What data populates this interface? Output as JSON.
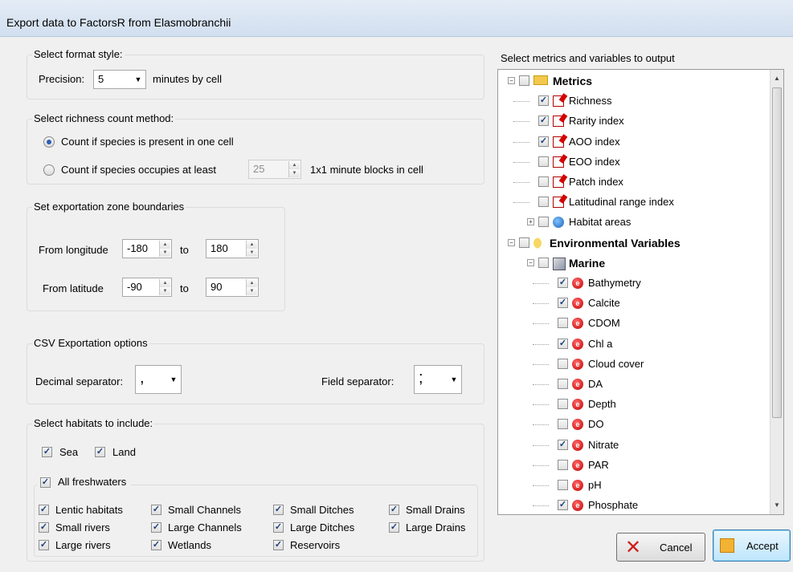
{
  "window": {
    "title": "Export data to FactorsR from Elasmobranchii"
  },
  "format": {
    "legend": "Select format style:",
    "precision_label": "Precision:",
    "precision_value": "5",
    "precision_suffix": "minutes by cell"
  },
  "richness": {
    "legend": "Select richness count method:",
    "option1": "Count if species is present in one cell",
    "option2_prefix": "Count if species occupies at least",
    "option2_value": "25",
    "option2_suffix": "1x1 minute blocks in cell",
    "selected": 1
  },
  "zone": {
    "legend": "Set exportation zone boundaries",
    "longitude_label": "From longitude",
    "longitude_from": "-180",
    "longitude_to": "180",
    "latitude_label": "From latitude",
    "latitude_from": "-90",
    "latitude_to": "90",
    "to_label": "to"
  },
  "csv": {
    "legend": "CSV Exportation options",
    "decimal_label": "Decimal separator:",
    "decimal_value": ",",
    "field_label": "Field separator:",
    "field_value": ";"
  },
  "habitats": {
    "legend": "Select habitats to include:",
    "sea": "Sea",
    "land": "Land",
    "all_freshwaters": "All freshwaters",
    "items": [
      {
        "label": "Lentic habitats",
        "checked": true
      },
      {
        "label": "Small Channels",
        "checked": true
      },
      {
        "label": "Small Ditches",
        "checked": true
      },
      {
        "label": "Small Drains",
        "checked": true
      },
      {
        "label": "Small rivers",
        "checked": true
      },
      {
        "label": "Large Channels",
        "checked": true
      },
      {
        "label": "Large Ditches",
        "checked": true
      },
      {
        "label": "Large Drains",
        "checked": true
      },
      {
        "label": "Large rivers",
        "checked": true
      },
      {
        "label": "Wetlands",
        "checked": true
      },
      {
        "label": "Reservoirs",
        "checked": true
      }
    ]
  },
  "tree": {
    "header": "Select metrics and variables to output",
    "metrics": "Metrics",
    "metric_items": [
      {
        "label": "Richness",
        "checked": true
      },
      {
        "label": "Rarity index",
        "checked": true
      },
      {
        "label": "AOO index",
        "checked": true
      },
      {
        "label": "EOO index",
        "checked": false
      },
      {
        "label": "Patch index",
        "checked": false
      },
      {
        "label": "Latitudinal range index",
        "checked": false
      }
    ],
    "habitat_areas": "Habitat areas",
    "env": "Environmental Variables",
    "marine": "Marine",
    "marine_items": [
      {
        "label": "Bathymetry",
        "checked": true
      },
      {
        "label": "Calcite",
        "checked": true
      },
      {
        "label": "CDOM",
        "checked": false
      },
      {
        "label": "Chl a",
        "checked": true
      },
      {
        "label": "Cloud cover",
        "checked": false
      },
      {
        "label": "DA",
        "checked": false
      },
      {
        "label": "Depth",
        "checked": false
      },
      {
        "label": "DO",
        "checked": false
      },
      {
        "label": "Nitrate",
        "checked": true
      },
      {
        "label": "PAR",
        "checked": false
      },
      {
        "label": "pH",
        "checked": false
      },
      {
        "label": "Phosphate",
        "checked": true
      }
    ]
  },
  "buttons": {
    "cancel": "Cancel",
    "accept": "Accept"
  },
  "icons": {
    "cancel": "x-icon",
    "accept": "accept-icon",
    "metric": "metric-icon",
    "env": "environment-variable-icon"
  },
  "colors": {
    "cancel_x": "#d01b1b",
    "accent": "#2a5db8"
  }
}
